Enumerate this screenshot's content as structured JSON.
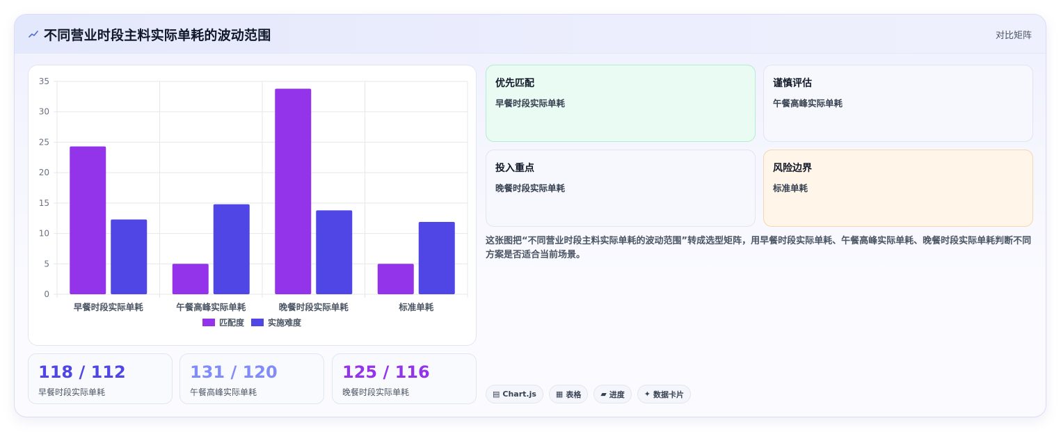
{
  "header": {
    "title": "不同营业时段主料实际单耗的波动范围",
    "action_label": "对比矩阵"
  },
  "colors": {
    "series_match": "#9333ea",
    "series_difficulty": "#4f46e5",
    "stat_1": "#4f46e5",
    "stat_2": "#818cf8",
    "stat_3": "#9333ea"
  },
  "chart_data": {
    "type": "bar",
    "categories": [
      "早餐时段实际单耗",
      "午餐高峰实际单耗",
      "晚餐时段实际单耗",
      "标准单耗"
    ],
    "series": [
      {
        "name": "匹配度",
        "values": [
          24.3,
          5,
          33.8,
          5
        ],
        "color": "#9333ea"
      },
      {
        "name": "实施难度",
        "values": [
          12.3,
          14.8,
          13.8,
          11.9
        ],
        "color": "#4f46e5"
      }
    ],
    "ylim": [
      0,
      35
    ],
    "yticks": [
      "0",
      "5",
      "10",
      "15",
      "20",
      "25",
      "30",
      "35"
    ],
    "grid": true,
    "legend_position": "bottom"
  },
  "stats": [
    {
      "value": "118 / 112",
      "label": "早餐时段实际单耗"
    },
    {
      "value": "131 / 120",
      "label": "午餐高峰实际单耗"
    },
    {
      "value": "125 / 116",
      "label": "晚餐时段实际单耗"
    }
  ],
  "matrix": [
    {
      "title": "优先匹配",
      "value": "早餐时段实际单耗"
    },
    {
      "title": "谨慎评估",
      "value": "午餐高峰实际单耗"
    },
    {
      "title": "投入重点",
      "value": "晚餐时段实际单耗"
    },
    {
      "title": "风险边界",
      "value": "标准单耗"
    }
  ],
  "description": "这张图把“不同营业时段主料实际单耗的波动范围”转成选型矩阵，用早餐时段实际单耗、午餐高峰实际单耗、晚餐时段实际单耗判断不同方案是否适合当前场景。",
  "tags": [
    {
      "icon": "▤",
      "icon_name": "chart-icon",
      "label": "Chart.js"
    },
    {
      "icon": "▦",
      "icon_name": "table-icon",
      "label": "表格"
    },
    {
      "icon": "▰",
      "icon_name": "progress-icon",
      "label": "进度"
    },
    {
      "icon": "✦",
      "icon_name": "sparkle-icon",
      "label": "数据卡片"
    }
  ]
}
